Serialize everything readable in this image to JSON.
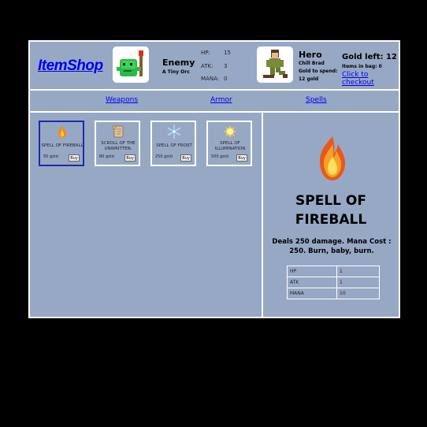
{
  "header": {
    "logo": "ItemShop",
    "enemy": {
      "name": "Enemy",
      "subtitle": "A Tiny Orc"
    },
    "enemy_stats": [
      {
        "label": "HP:",
        "value": "15"
      },
      {
        "label": "ATK:",
        "value": "3"
      },
      {
        "label": "MANA:",
        "value": "0"
      }
    ],
    "hero": {
      "name": "Hero",
      "line1": "Chill Brad",
      "line2": "Gold to spend:",
      "line3": "12 gold"
    },
    "gold_left": "Gold left: 12",
    "items_in_bag": "Items in bag: 0",
    "checkout": "Click to checkout"
  },
  "nav": {
    "weapons": "Weapons",
    "armor": "Armor",
    "spells": "Spells"
  },
  "items": [
    {
      "name": "SPELL OF FIREBALL",
      "price": "50 gold",
      "buy": "Buy",
      "icon": "fireball-icon"
    },
    {
      "name": "SCROLL OF THE UNWRITTEN.",
      "price": "80 gold",
      "buy": "Buy",
      "icon": "scroll-icon"
    },
    {
      "name": "SPELL OF FROST",
      "price": "250 gold",
      "buy": "Buy",
      "icon": "snowflake-icon"
    },
    {
      "name": "SPELL OF ILLUMINATION",
      "price": "500 gold",
      "buy": "Buy",
      "icon": "sun-icon"
    }
  ],
  "detail": {
    "title": "SPELL OF FIREBALL",
    "description": "Deals 250 damage. Mana Cost : 250. Burn, baby, burn.",
    "stats": [
      {
        "label": "HP",
        "value": "1"
      },
      {
        "label": "ATK",
        "value": "1"
      },
      {
        "label": "MANA",
        "value": "10"
      }
    ]
  },
  "colors": {
    "panel": "#97a8c5",
    "link": "#0000ee",
    "selected_border": "#1f2aa8"
  }
}
